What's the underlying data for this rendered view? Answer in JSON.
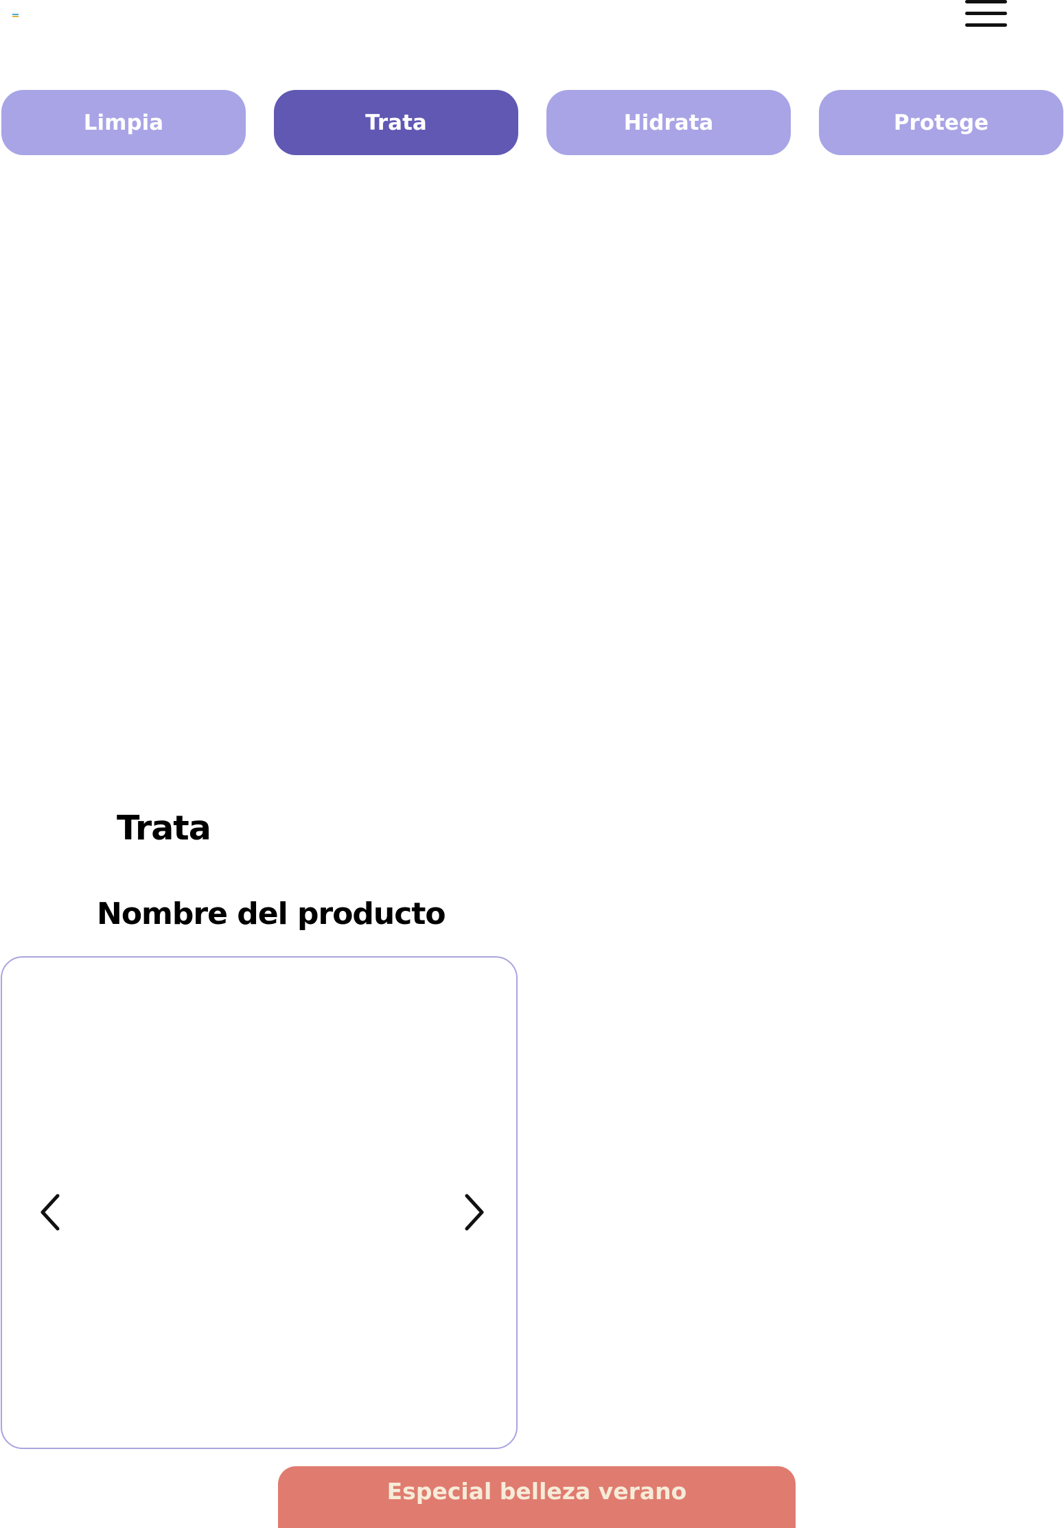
{
  "header": {
    "logo_icon": "multicolor-logo-mark",
    "menu_icon": "hamburger-menu-icon"
  },
  "colors": {
    "tab_inactive": "#a8a4e6",
    "tab_active": "#6158b4",
    "carousel_border": "#a9a4e0",
    "promo_banner": "#e07b70",
    "promo_text": "#f6ecd8",
    "text": "#000000"
  },
  "tabs": [
    {
      "label": "Limpia",
      "active": false
    },
    {
      "label": "Trata",
      "active": true
    },
    {
      "label": "Hidrata",
      "active": false
    },
    {
      "label": "Protege",
      "active": false
    }
  ],
  "section": {
    "title": "Trata"
  },
  "product": {
    "name": "Nombre del producto"
  },
  "carousel": {
    "prev_icon": "chevron-left-icon",
    "next_icon": "chevron-right-icon"
  },
  "promo": {
    "label": "Especial belleza verano"
  }
}
